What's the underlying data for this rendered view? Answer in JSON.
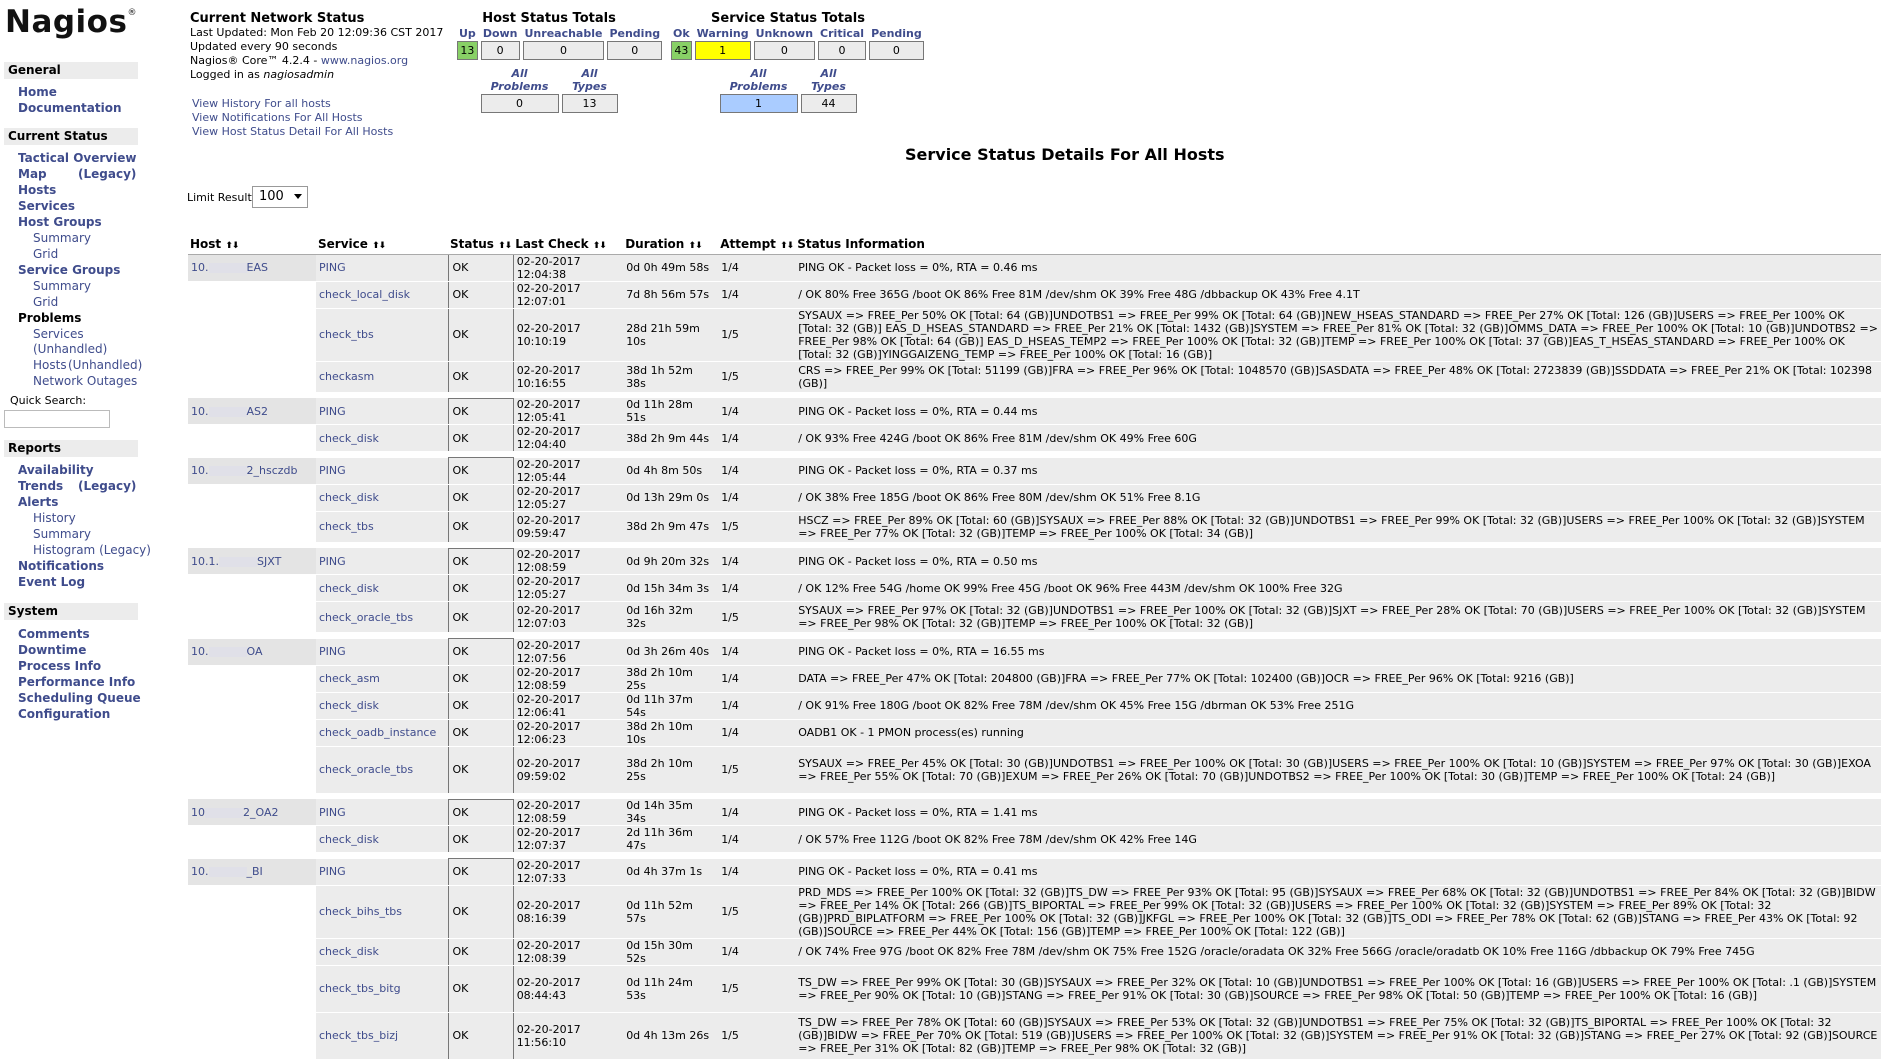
{
  "logo": {
    "text": "Nagios",
    "mark": "®"
  },
  "sidebar": {
    "general": {
      "title": "General",
      "items": [
        "Home",
        "Documentation"
      ]
    },
    "current_status": {
      "title": "Current Status",
      "tactical": "Tactical Overview",
      "map": "Map",
      "map_legacy": "(Legacy)",
      "hosts": "Hosts",
      "services": "Services",
      "host_groups": "Host Groups",
      "hg_summary": "Summary",
      "hg_grid": "Grid",
      "service_groups": "Service Groups",
      "sg_summary": "Summary",
      "sg_grid": "Grid",
      "problems": "Problems",
      "p_services": "Services",
      "p_unhandled_1": "(Unhandled)",
      "p_hosts": "Hosts",
      "p_unhandled_2": "(Unhandled)",
      "p_outages": "Network Outages",
      "quick_search": "Quick Search:"
    },
    "reports": {
      "title": "Reports",
      "availability": "Availability",
      "trends": "Trends",
      "trends_legacy": "(Legacy)",
      "alerts": "Alerts",
      "history": "History",
      "summary": "Summary",
      "histogram": "Histogram (Legacy)",
      "notifications": "Notifications",
      "event_log": "Event Log"
    },
    "system": {
      "title": "System",
      "items": [
        "Comments",
        "Downtime",
        "Process Info",
        "Performance Info",
        "Scheduling Queue",
        "Configuration"
      ]
    }
  },
  "network_status": {
    "title": "Current Network Status",
    "updated": "Last Updated: Mon Feb 20 12:09:36 CST 2017",
    "interval": "Updated every 90 seconds",
    "version_prefix": "Nagios® Core™ 4.2.4 - ",
    "version_link": "www.nagios.org",
    "logged_prefix": "Logged in as ",
    "logged_user": "nagiosadmin",
    "links": [
      "View History For all hosts",
      "View Notifications For All Hosts",
      "View Host Status Detail For All Hosts"
    ]
  },
  "host_totals": {
    "title": "Host Status Totals",
    "labels": [
      "Up",
      "Down",
      "Unreachable",
      "Pending"
    ],
    "values": [
      "13",
      "0",
      "0",
      "0"
    ],
    "sum_labels": [
      "All Problems",
      "All Types"
    ],
    "sum_values": [
      "0",
      "13"
    ]
  },
  "service_totals": {
    "title": "Service Status Totals",
    "labels": [
      "Ok",
      "Warning",
      "Unknown",
      "Critical",
      "Pending"
    ],
    "values": [
      "43",
      "1",
      "0",
      "0",
      "0"
    ],
    "sum_labels": [
      "All Problems",
      "All Types"
    ],
    "sum_values": [
      "1",
      "44"
    ]
  },
  "page_title": "Service Status Details For All Hosts",
  "limit": {
    "label": "Limit Results:",
    "value": "100"
  },
  "table": {
    "headers": [
      "Host",
      "Service",
      "Status",
      "Last Check",
      "Duration",
      "Attempt",
      "Status Information"
    ],
    "groups": [
      {
        "host_a": "10.",
        "host_b": "EAS",
        "rows": [
          {
            "service": "PING",
            "status": "OK",
            "last": "02-20-2017 12:04:38",
            "dur": "0d 0h 49m 58s",
            "att": "1/4",
            "info": "PING OK - Packet loss = 0%, RTA = 0.46 ms"
          },
          {
            "service": "check_local_disk",
            "status": "OK",
            "last": "02-20-2017 12:07:01",
            "dur": "7d 8h 56m 57s",
            "att": "1/4",
            "info": "/ OK 80% Free 365G /boot OK 86% Free 81M /dev/shm OK 39% Free 48G /dbbackup OK 43% Free 4.1T"
          },
          {
            "service": "check_tbs",
            "status": "OK",
            "last": "02-20-2017 10:10:19",
            "dur": "28d 21h 59m 10s",
            "att": "1/5",
            "info": "SYSAUX => FREE_Per 50% OK [Total: 64 (GB)]UNDOTBS1 => FREE_Per 99% OK [Total: 64 (GB)]NEW_HSEAS_STANDARD => FREE_Per 27% OK [Total: 126 (GB)]USERS => FREE_Per 100% OK [Total: 32 (GB)] EAS_D_HSEAS_STANDARD => FREE_Per 21% OK [Total: 1432 (GB)]SYSTEM => FREE_Per 81% OK [Total: 32 (GB)]OMMS_DATA => FREE_Per 100% OK [Total: 10 (GB)]UNDOTBS2 => FREE_Per 98% OK [Total: 64 (GB)] EAS_D_HSEAS_TEMP2 => FREE_Per 100% OK [Total: 32 (GB)]TEMP => FREE_Per 100% OK [Total: 37 (GB)]EAS_T_HSEAS_STANDARD => FREE_Per 100% OK [Total: 32 (GB)]YINGGAIZENG_TEMP => FREE_Per 100% OK [Total: 16 (GB)]"
          },
          {
            "service": "checkasm",
            "status": "OK",
            "last": "02-20-2017 10:16:55",
            "dur": "38d 1h 52m 38s",
            "att": "1/5",
            "info": "CRS => FREE_Per 99% OK [Total: 51199 (GB)]FRA => FREE_Per 96% OK [Total: 1048570 (GB)]SASDATA => FREE_Per 48% OK [Total: 2723839 (GB)]SSDDATA => FREE_Per 21% OK [Total: 102398 (GB)]"
          }
        ]
      },
      {
        "host_a": "10.",
        "host_b": "AS2",
        "rows": [
          {
            "service": "PING",
            "status": "OK",
            "last": "02-20-2017 12:05:41",
            "dur": "0d 11h 28m 51s",
            "att": "1/4",
            "info": "PING OK - Packet loss = 0%, RTA = 0.44 ms"
          },
          {
            "service": "check_disk",
            "status": "OK",
            "last": "02-20-2017 12:04:40",
            "dur": "38d 2h 9m 44s",
            "att": "1/4",
            "info": "/ OK 93% Free 424G /boot OK 86% Free 81M /dev/shm OK 49% Free 60G"
          }
        ]
      },
      {
        "host_a": "10.",
        "host_b": "2_hsczdb",
        "rows": [
          {
            "service": "PING",
            "status": "OK",
            "last": "02-20-2017 12:05:44",
            "dur": "0d 4h 8m 50s",
            "att": "1/4",
            "info": "PING OK - Packet loss = 0%, RTA = 0.37 ms"
          },
          {
            "service": "check_disk",
            "status": "OK",
            "last": "02-20-2017 12:05:27",
            "dur": "0d 13h 29m 0s",
            "att": "1/4",
            "info": "/ OK 38% Free 185G /boot OK 86% Free 80M /dev/shm OK 51% Free 8.1G"
          },
          {
            "service": "check_tbs",
            "status": "OK",
            "last": "02-20-2017 09:59:47",
            "dur": "38d 2h 9m 47s",
            "att": "1/5",
            "info": "HSCZ => FREE_Per 89% OK [Total: 60 (GB)]SYSAUX => FREE_Per 88% OK [Total: 32 (GB)]UNDOTBS1 => FREE_Per 99% OK [Total: 32 (GB)]USERS => FREE_Per 100% OK [Total: 32 (GB)]SYSTEM => FREE_Per 77% OK [Total: 32 (GB)]TEMP => FREE_Per 100% OK [Total: 34 (GB)]"
          }
        ]
      },
      {
        "host_a": "10.1.",
        "host_b": "SJXT",
        "rows": [
          {
            "service": "PING",
            "status": "OK",
            "last": "02-20-2017 12:08:59",
            "dur": "0d 9h 20m 32s",
            "att": "1/4",
            "info": "PING OK - Packet loss = 0%, RTA = 0.50 ms"
          },
          {
            "service": "check_disk",
            "status": "OK",
            "last": "02-20-2017 12:05:27",
            "dur": "0d 15h 34m 3s",
            "att": "1/4",
            "info": "/ OK 12% Free 54G /home OK 99% Free 45G /boot OK 96% Free 443M /dev/shm OK 100% Free 32G"
          },
          {
            "service": "check_oracle_tbs",
            "status": "OK",
            "last": "02-20-2017 12:07:03",
            "dur": "0d 16h 32m 32s",
            "att": "1/5",
            "info": "SYSAUX => FREE_Per 97% OK [Total: 32 (GB)]UNDOTBS1 => FREE_Per 100% OK [Total: 32 (GB)]SJXT => FREE_Per 28% OK [Total: 70 (GB)]USERS => FREE_Per 100% OK [Total: 32 (GB)]SYSTEM => FREE_Per 98% OK [Total: 32 (GB)]TEMP => FREE_Per 100% OK [Total: 32 (GB)]"
          }
        ]
      },
      {
        "host_a": "10.",
        "host_b": "OA",
        "rows": [
          {
            "service": "PING",
            "status": "OK",
            "last": "02-20-2017 12:07:56",
            "dur": "0d 3h 26m 40s",
            "att": "1/4",
            "info": "PING OK - Packet loss = 0%, RTA = 16.55 ms"
          },
          {
            "service": "check_asm",
            "status": "OK",
            "last": "02-20-2017 12:08:59",
            "dur": "38d 2h 10m 25s",
            "att": "1/4",
            "info": "DATA => FREE_Per 47% OK [Total: 204800 (GB)]FRA => FREE_Per 77% OK [Total: 102400 (GB)]OCR => FREE_Per 96% OK [Total: 9216 (GB)]"
          },
          {
            "service": "check_disk",
            "status": "OK",
            "last": "02-20-2017 12:06:41",
            "dur": "0d 11h 37m 54s",
            "att": "1/4",
            "info": "/ OK 91% Free 180G /boot OK 82% Free 78M /dev/shm OK 45% Free 15G /dbrman OK 53% Free 251G"
          },
          {
            "service": "check_oadb_instance",
            "status": "OK",
            "last": "02-20-2017 12:06:23",
            "dur": "38d 2h 10m 10s",
            "att": "1/4",
            "info": "OADB1 OK - 1 PMON process(es) running"
          },
          {
            "service": "check_oracle_tbs",
            "status": "OK",
            "last": "02-20-2017 09:59:02",
            "dur": "38d 2h 10m 25s",
            "att": "1/5",
            "info": "SYSAUX => FREE_Per 45% OK [Total: 30 (GB)]UNDOTBS1 => FREE_Per 100% OK [Total: 30 (GB)]USERS => FREE_Per 100% OK [Total: 10 (GB)]SYSTEM => FREE_Per 97% OK [Total: 30 (GB)]EXOA => FREE_Per 55% OK [Total: 70 (GB)]EXUM => FREE_Per 26% OK [Total: 70 (GB)]UNDOTBS2 => FREE_Per 100% OK [Total: 30 (GB)]TEMP => FREE_Per 100% OK [Total: 24 (GB)]"
          }
        ]
      },
      {
        "host_a": "10",
        "host_b": "2_OA2",
        "rows": [
          {
            "service": "PING",
            "status": "OK",
            "last": "02-20-2017 12:08:59",
            "dur": "0d 14h 35m 34s",
            "att": "1/4",
            "info": "PING OK - Packet loss = 0%, RTA = 1.41 ms"
          },
          {
            "service": "check_disk",
            "status": "OK",
            "last": "02-20-2017 12:07:37",
            "dur": "2d 11h 36m 47s",
            "att": "1/4",
            "info": "/ OK 57% Free 112G /boot OK 82% Free 78M /dev/shm OK 42% Free 14G"
          }
        ]
      },
      {
        "host_a": "10.",
        "host_b": "_BI",
        "rows": [
          {
            "service": "PING",
            "status": "OK",
            "last": "02-20-2017 12:07:33",
            "dur": "0d 4h 37m 1s",
            "att": "1/4",
            "info": "PING OK - Packet loss = 0%, RTA = 0.41 ms"
          },
          {
            "service": "check_bihs_tbs",
            "status": "OK",
            "last": "02-20-2017 08:16:39",
            "dur": "0d 11h 52m 57s",
            "att": "1/5",
            "info": "PRD_MDS => FREE_Per 100% OK [Total: 32 (GB)]TS_DW => FREE_Per 93% OK [Total: 95 (GB)]SYSAUX => FREE_Per 68% OK [Total: 32 (GB)]UNDOTBS1 => FREE_Per 84% OK [Total: 32 (GB)]BIDW => FREE_Per 14% OK [Total: 266 (GB)]TS_BIPORTAL => FREE_Per 99% OK [Total: 32 (GB)]USERS => FREE_Per 100% OK [Total: 32 (GB)]SYSTEM => FREE_Per 89% OK [Total: 32 (GB)]PRD_BIPLATFORM => FREE_Per 100% OK [Total: 32 (GB)]JKFGL => FREE_Per 100% OK [Total: 32 (GB)]TS_ODI => FREE_Per 78% OK [Total: 62 (GB)]STANG => FREE_Per 43% OK [Total: 92 (GB)]SOURCE => FREE_Per 44% OK [Total: 156 (GB)]TEMP => FREE_Per 100% OK [Total: 122 (GB)]"
          },
          {
            "service": "check_disk",
            "status": "OK",
            "last": "02-20-2017 12:08:39",
            "dur": "0d 15h 30m 52s",
            "att": "1/4",
            "info": "/ OK 74% Free 97G /boot OK 82% Free 78M /dev/shm OK 75% Free 152G /oracle/oradata OK 32% Free 566G /oracle/oradatb OK 10% Free 116G /dbbackup OK 79% Free 745G"
          },
          {
            "service": "check_tbs_bitg",
            "status": "OK",
            "last": "02-20-2017 08:44:43",
            "dur": "0d 11h 24m 53s",
            "att": "1/5",
            "info": "TS_DW => FREE_Per 99% OK [Total: 30 (GB)]SYSAUX => FREE_Per 32% OK [Total: 10 (GB)]UNDOTBS1 => FREE_Per 100% OK [Total: 16 (GB)]USERS => FREE_Per 100% OK [Total: .1 (GB)]SYSTEM => FREE_Per 90% OK [Total: 10 (GB)]STANG => FREE_Per 91% OK [Total: 30 (GB)]SOURCE => FREE_Per 98% OK [Total: 50 (GB)]TEMP => FREE_Per 100% OK [Total: 16 (GB)]"
          },
          {
            "service": "check_tbs_bizj",
            "status": "OK",
            "last": "02-20-2017 11:56:10",
            "dur": "0d 4h 13m 26s",
            "att": "1/5",
            "info": "TS_DW => FREE_Per 78% OK [Total: 60 (GB)]SYSAUX => FREE_Per 53% OK [Total: 32 (GB)]UNDOTBS1 => FREE_Per 75% OK [Total: 32 (GB)]TS_BIPORTAL => FREE_Per 100% OK [Total: 32 (GB)]BIDW => FREE_Per 70% OK [Total: 519 (GB)]USERS => FREE_Per 100% OK [Total: 32 (GB)]SYSTEM => FREE_Per 91% OK [Total: 32 (GB)]STANG => FREE_Per 27% OK [Total: 92 (GB)]SOURCE => FREE_Per 31% OK [Total: 82 (GB)]TEMP => FREE_Per 98% OK [Total: 32 (GB)]"
          }
        ]
      }
    ]
  },
  "colors": {
    "ok": "#88d066",
    "warning": "#ffff00",
    "link": "#3f4c8c",
    "row_bg": "#ececec",
    "problems_bg": "#aaccff"
  }
}
